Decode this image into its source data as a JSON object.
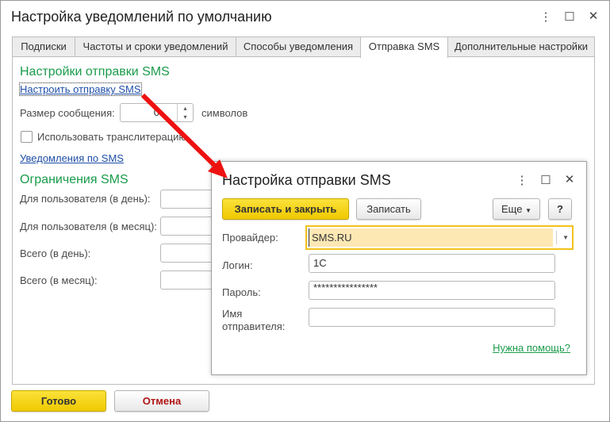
{
  "window": {
    "title": "Настройка уведомлений по умолчанию"
  },
  "tabs": [
    "Подписки",
    "Частоты и сроки уведомлений",
    "Способы уведомления",
    "Отправка SMS",
    "Дополнительные настройки"
  ],
  "sms": {
    "heading": "Настройки отправки SMS",
    "configure_link": "Настроить отправку SMS",
    "msg_size_label": "Размер сообщения:",
    "msg_size_value": "0",
    "msg_size_unit": "символов",
    "translit_label": "Использовать транслитерацию",
    "translit_checked": false,
    "notifications_link": "Уведомления по SMS",
    "limits_heading": "Ограничения SMS",
    "limits": [
      "Для пользователя (в день):",
      "Для пользователя (в месяц):",
      "Всего (в день):",
      "Всего (в месяц):"
    ]
  },
  "footer": {
    "ok": "Готово",
    "cancel": "Отмена"
  },
  "dialog": {
    "title": "Настройка отправки SMS",
    "save_close": "Записать и закрыть",
    "save": "Записать",
    "more": "Еще",
    "help": "?",
    "provider_label": "Провайдер:",
    "provider_value": "SMS.RU",
    "login_label": "Логин:",
    "login_value": "1C",
    "password_label": "Пароль:",
    "password_value": "****************",
    "sender_label": "Имя отправителя:",
    "sender_value": "",
    "help_link": "Нужна помощь?"
  },
  "colors": {
    "accent": "#1a9b4b",
    "link": "#1f4fa8",
    "arrow": "#ee1111",
    "primary": "#f5d400"
  }
}
